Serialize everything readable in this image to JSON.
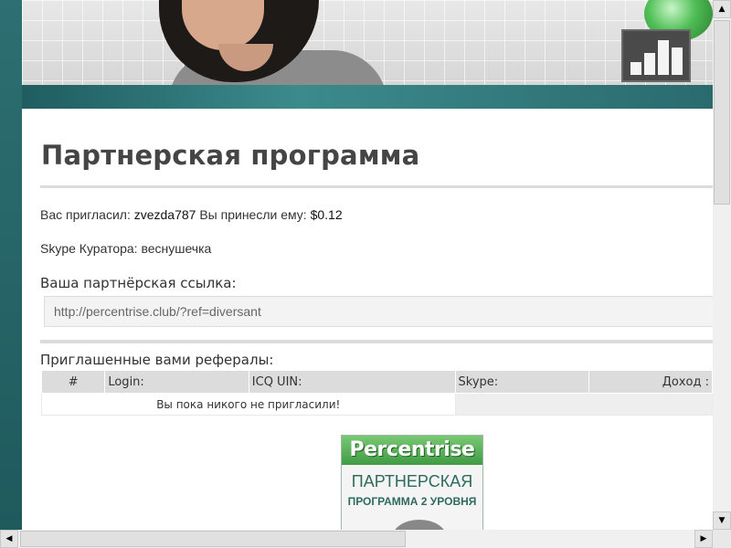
{
  "page": {
    "title": "Партнерская программа",
    "invited_by_label": "Вас пригласил:",
    "invited_by_user": "zvezda787",
    "earned_label": "Вы принесли ему:",
    "earned_value": "$0.12",
    "skype_curator": "Skype Куратора: веснушечка",
    "ref_link_label": "Ваша партнёрская ссылка:",
    "ref_link_value": "http://percentrise.club/?ref=diversant",
    "referrals_label": "Приглашенные вами рефералы:"
  },
  "referrals_table": {
    "columns": [
      "#",
      "Login:",
      "ICQ UIN:",
      "Skype:",
      "Доход :"
    ],
    "empty_message": "Вы пока никого не пригласили!"
  },
  "banner": {
    "logo_text": "Percentrise",
    "line1": "ПАРТНЕРСКАЯ",
    "line2": "ПРОГРАММА 2 УРОВНЯ"
  },
  "colors": {
    "accent_teal": "#2a6b6e",
    "title_gray": "#454545",
    "table_header": "#dcdcdc",
    "banner_green": "#3f9c44"
  },
  "icons": {
    "scroll_up": "▲",
    "scroll_down": "▼",
    "scroll_left": "◀",
    "scroll_right": "▶"
  }
}
